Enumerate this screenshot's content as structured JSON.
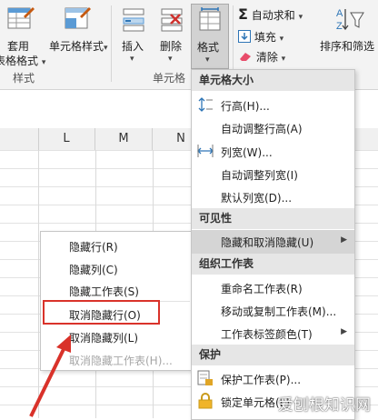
{
  "ribbon": {
    "apply_format": {
      "line1": "套用",
      "line2": "表格格式",
      "chev": "▾"
    },
    "cell_style": {
      "label": "单元格样式",
      "chev": "▾"
    },
    "insert": {
      "label": "插入",
      "chev": "▾"
    },
    "delete": {
      "label": "删除",
      "chev": "▾"
    },
    "format": {
      "label": "格式",
      "chev": "▾"
    },
    "autosum": {
      "label": "自动求和",
      "chev": "▾",
      "icon": "Σ"
    },
    "fill": {
      "label": "填充",
      "chev": "▾"
    },
    "clear": {
      "label": "清除",
      "chev": "▾"
    },
    "sort_filter": {
      "label": "排序和筛选"
    },
    "group_styles": "样式",
    "group_cells": "单元格"
  },
  "sheet": {
    "columns": [
      "L",
      "M",
      "N"
    ]
  },
  "format_menu": {
    "sections": {
      "cell_size": "单元格大小",
      "visibility": "可见性",
      "organize": "组织工作表",
      "protect": "保护"
    },
    "items": {
      "row_height": "行高(H)...",
      "autofit_row": "自动调整行高(A)",
      "col_width": "列宽(W)...",
      "autofit_col": "自动调整列宽(I)",
      "default_width": "默认列宽(D)...",
      "hide_unhide": "隐藏和取消隐藏(U)",
      "rename_sheet": "重命名工作表(R)",
      "move_copy": "移动或复制工作表(M)...",
      "tab_color": "工作表标签颜色(T)",
      "protect_sheet": "保护工作表(P)...",
      "lock_cell": "锁定单元格(L)"
    }
  },
  "hide_submenu": {
    "items": [
      "隐藏行(R)",
      "隐藏列(C)",
      "隐藏工作表(S)",
      "取消隐藏行(O)",
      "取消隐藏列(L)",
      "取消隐藏工作表(H)..."
    ]
  },
  "watermark": "爱刨根知识网",
  "colors": {
    "highlight_box": "#d9322a",
    "menu_hover": "#d5d5d5",
    "section_bg": "#e6e6e6"
  }
}
